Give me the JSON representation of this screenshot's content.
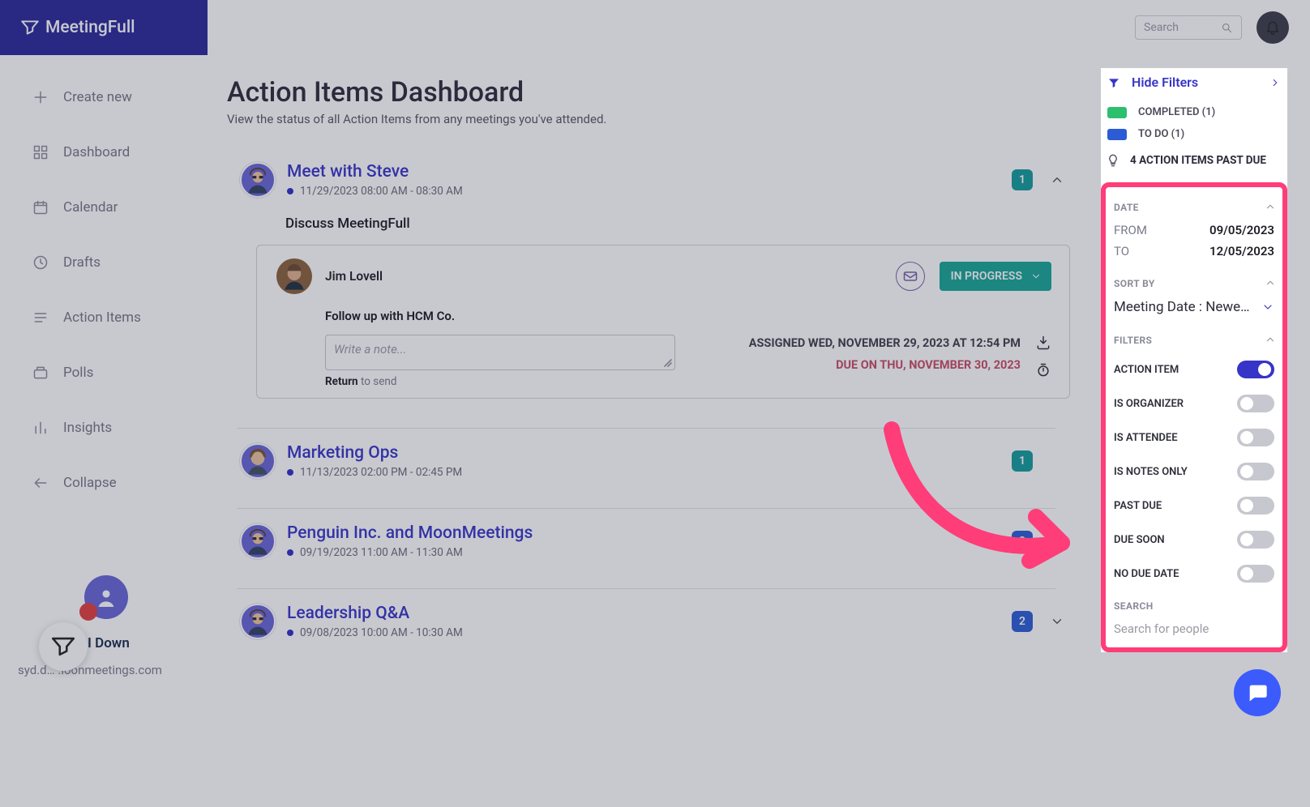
{
  "brand": "MeetingFull",
  "sidebar": {
    "items": [
      {
        "label": "Create new",
        "icon": "plus"
      },
      {
        "label": "Dashboard",
        "icon": "grid"
      },
      {
        "label": "Calendar",
        "icon": "calendar"
      },
      {
        "label": "Drafts",
        "icon": "clock"
      },
      {
        "label": "Action Items",
        "icon": "list"
      },
      {
        "label": "Polls",
        "icon": "poll"
      },
      {
        "label": "Insights",
        "icon": "bars"
      },
      {
        "label": "Collapse",
        "icon": "arrow-left"
      }
    ],
    "user_name": "I Down",
    "user_email": "syd.d…  .ioonmeetings.com"
  },
  "topbar": {
    "search_placeholder": "Search"
  },
  "page": {
    "title": "Action Items Dashboard",
    "subtitle": "View the status of all Action Items from any meetings you've attended."
  },
  "meetings": [
    {
      "title": "Meet with Steve",
      "time": "11/29/2023 08:00 AM - 08:30 AM",
      "count": "1",
      "count_style": "teal",
      "expanded": true,
      "topic": "Discuss MeetingFull",
      "action_item": {
        "assignee": "Jim Lovell",
        "desc": "Follow up with HCM Co.",
        "note_placeholder": "Write a note...",
        "return_label": "Return",
        "return_rest": " to send",
        "status": "IN PROGRESS",
        "assigned": "ASSIGNED WED, NOVEMBER 29, 2023 AT 12:54 PM",
        "due": "DUE ON THU, NOVEMBER 30, 2023"
      }
    },
    {
      "title": "Marketing Ops",
      "time": "11/13/2023 02:00 PM - 02:45 PM",
      "count": "1",
      "count_style": "teal",
      "expanded": false
    },
    {
      "title": "Penguin Inc. and MoonMeetings",
      "time": "09/19/2023 11:00 AM - 11:30 AM",
      "count": "3",
      "count_style": "blue",
      "expanded": false
    },
    {
      "title": "Leadership Q&A",
      "time": "09/08/2023 10:00 AM - 10:30 AM",
      "count": "2",
      "count_style": "blue",
      "expanded": false
    }
  ],
  "filters": {
    "hide_label": "Hide Filters",
    "completed": "COMPLETED (1)",
    "todo": "TO DO (1)",
    "pastdue": "4 ACTION ITEMS PAST DUE",
    "date_section": "DATE",
    "from_label": "FROM",
    "from_value": "09/05/2023",
    "to_label": "TO",
    "to_value": "12/05/2023",
    "sort_section": "SORT BY",
    "sort_value": "Meeting Date : Newe…",
    "filters_section": "FILTERS",
    "toggles": [
      {
        "label": "ACTION ITEM",
        "on": true
      },
      {
        "label": "IS ORGANIZER",
        "on": false
      },
      {
        "label": "IS ATTENDEE",
        "on": false
      },
      {
        "label": "IS NOTES ONLY",
        "on": false
      },
      {
        "label": "PAST DUE",
        "on": false
      },
      {
        "label": "DUE SOON",
        "on": false
      },
      {
        "label": "NO DUE DATE",
        "on": false
      }
    ],
    "search_section": "SEARCH",
    "search_placeholder": "Search for people"
  }
}
